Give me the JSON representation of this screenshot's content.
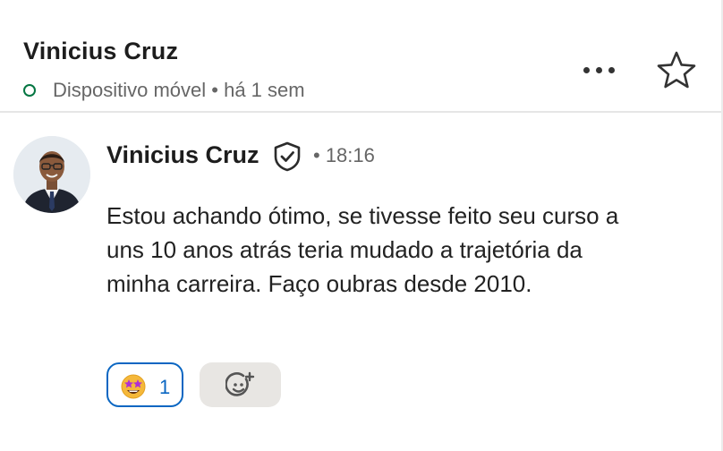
{
  "conversation": {
    "title": "Vinicius Cruz",
    "status": "Dispositivo móvel • há 1 sem"
  },
  "message": {
    "sender": "Vinicius Cruz",
    "time": "• 18:16",
    "text": "Estou achando ótimo, se tivesse feito seu curso a uns 10 anos atrás teria mudado a trajetória da minha carreira. Faço oubras desde 2010."
  },
  "reactions": [
    {
      "emoji": "star-struck-emoji",
      "count": "1"
    }
  ],
  "icons": {
    "presence": "online-dot-icon",
    "more": "more-options-icon",
    "star": "star-icon",
    "verified": "verified-shield-icon",
    "add_reaction": "add-reaction-icon"
  },
  "colors": {
    "presence_green": "#057642",
    "reaction_blue": "#0a66c2",
    "add_reaction_bg": "#e8e6e3"
  }
}
